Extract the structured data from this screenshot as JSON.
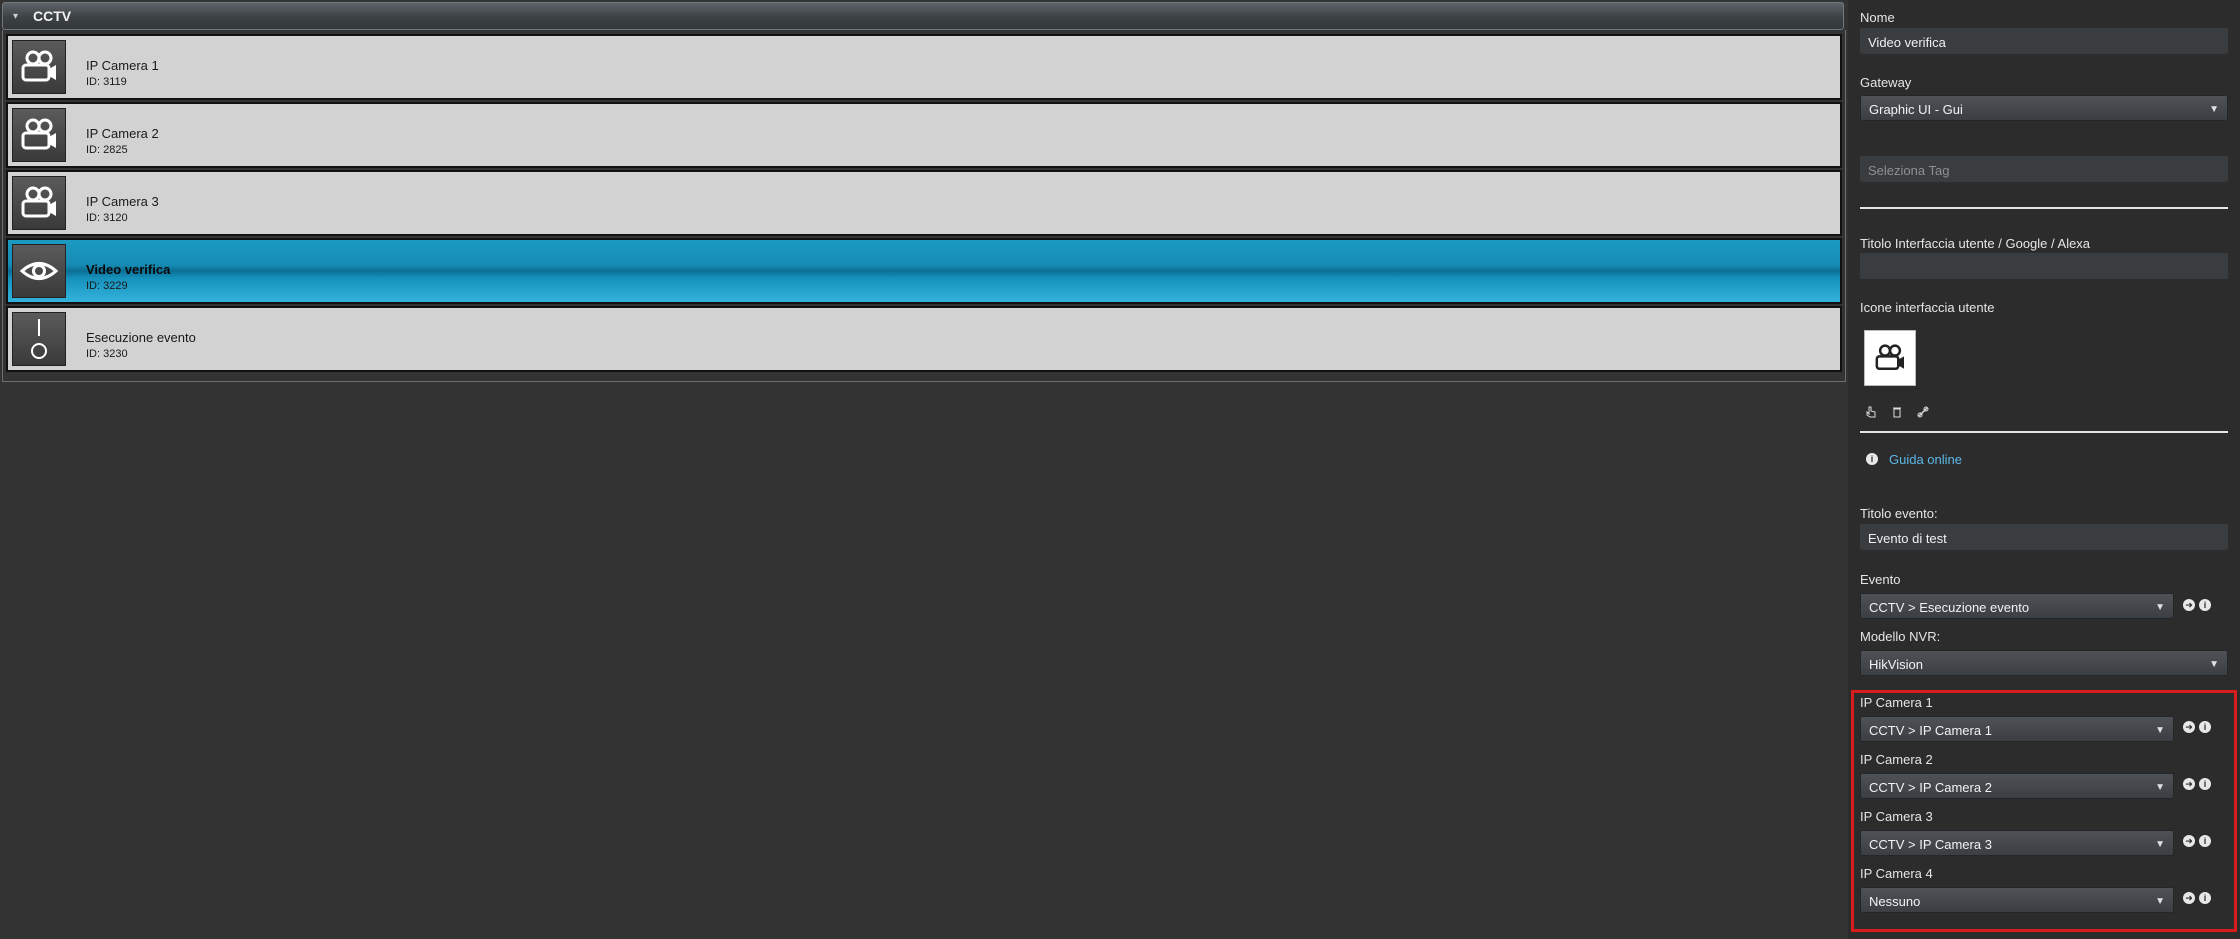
{
  "group": {
    "title": "CCTV"
  },
  "items": [
    {
      "name": "IP Camera 1",
      "id": "ID: 3119",
      "icon": "camera-icon"
    },
    {
      "name": "IP Camera 2",
      "id": "ID: 2825",
      "icon": "camera-icon"
    },
    {
      "name": "IP Camera 3",
      "id": "ID: 3120",
      "icon": "camera-icon"
    },
    {
      "name": "Video verifica",
      "id": "ID: 3229",
      "icon": "eye-icon",
      "selected": true
    },
    {
      "name": "Esecuzione evento",
      "id": "ID: 3230",
      "icon": "switch-icon"
    }
  ],
  "panel": {
    "nome_label": "Nome",
    "nome_value": "Video verifica",
    "gateway_label": "Gateway",
    "gateway_value": "Graphic UI - Gui",
    "tag_placeholder": "Seleziona Tag",
    "titolo_ui_label": "Titolo Interfaccia utente / Google / Alexa",
    "titolo_ui_value": "",
    "icone_label": "Icone interfaccia utente",
    "guida_link": "Guida online",
    "titolo_evento_label": "Titolo evento:",
    "titolo_evento_value": "Evento di test",
    "evento_label": "Evento",
    "evento_value": "CCTV > Esecuzione evento",
    "modello_label": "Modello NVR:",
    "modello_value": "HikVision",
    "cameras": [
      {
        "label": "IP Camera 1",
        "value": "CCTV > IP Camera 1"
      },
      {
        "label": "IP Camera 2",
        "value": "CCTV > IP Camera 2"
      },
      {
        "label": "IP Camera 3",
        "value": "CCTV > IP Camera 3"
      },
      {
        "label": "IP Camera 4",
        "value": "Nessuno"
      }
    ]
  },
  "colors": {
    "selected": "#168cb5",
    "highlight_box": "#d81c1c",
    "link": "#5bb8e6"
  }
}
